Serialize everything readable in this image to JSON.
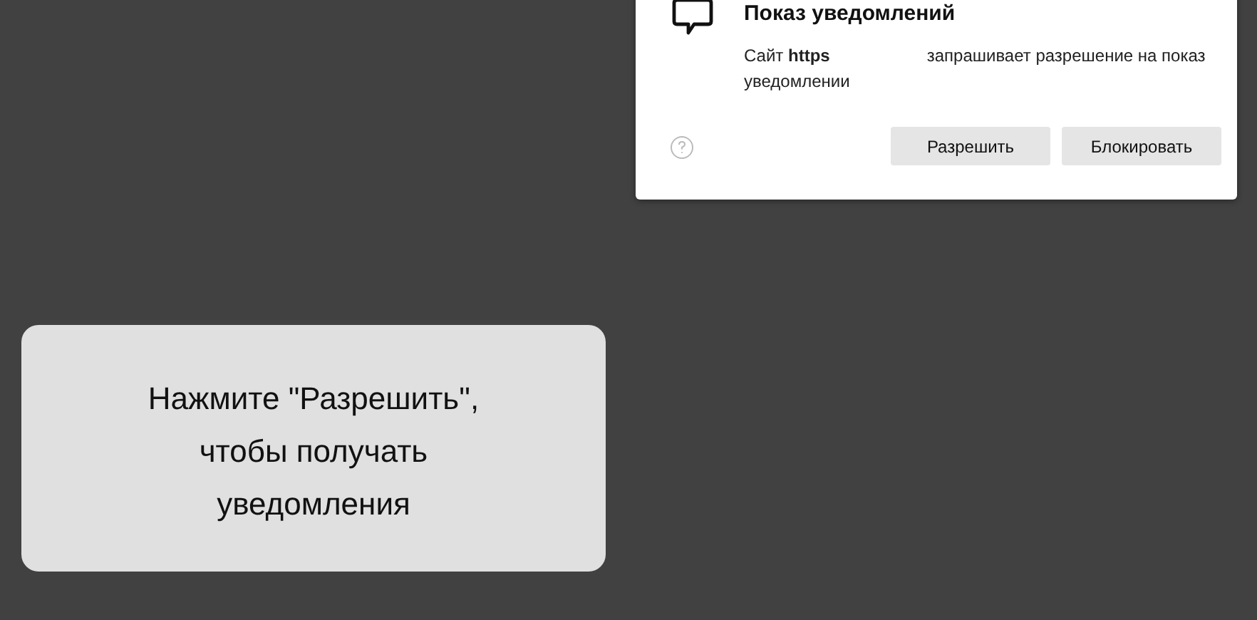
{
  "permission_dialog": {
    "title": "Показ уведомлений",
    "message_start": "Сайт **https**",
    "message_end": "запрашивает разрешение на показ уведомлении",
    "buttons": [
      "Разрешить",
      "Блокировать"
    ]
  },
  "hint_overlay": {
    "lines": [
      "Нажмите \"Разрешить\",",
      "чтобы получать",
      "уведомления"
    ]
  }
}
